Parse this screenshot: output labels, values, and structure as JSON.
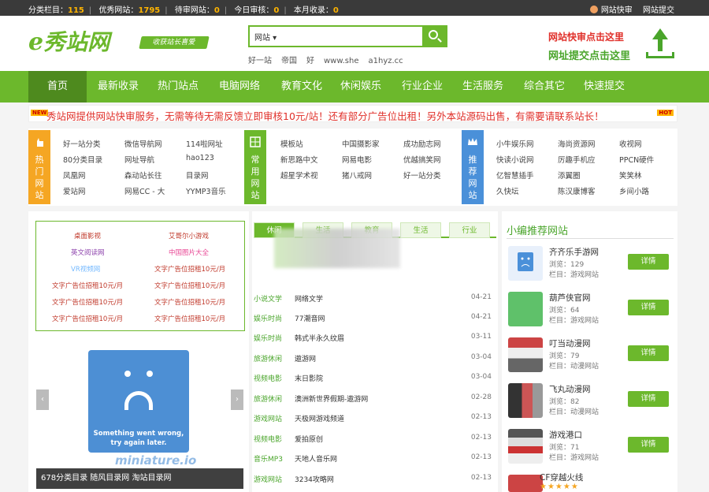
{
  "topbar": {
    "cat_label": "分类栏目：",
    "cat_count": "115",
    "site_label": "优秀网站：",
    "site_count": "1795",
    "pending_label": "待审网站：",
    "pending_count": "0",
    "today_label": "今日审核：",
    "today_count": "0",
    "month_label": "本月收录：",
    "month_count": "0",
    "link_fast": "网站快审",
    "link_submit": "网站提交"
  },
  "header": {
    "logo_text": "秀站网",
    "slogan": "收获站长喜爱",
    "search_type": "网站 ▾",
    "search_placeholder": "",
    "hotwords": [
      "好一站",
      "帝国",
      "好",
      "www.she",
      "a1hyz.cc"
    ],
    "quick_line1": "网站快审点击这里",
    "quick_line2": "网址提交点击这里"
  },
  "nav": {
    "items": [
      "首页",
      "最新收录",
      "热门站点",
      "电脑网络",
      "教育文化",
      "休闲娱乐",
      "行业企业",
      "生活服务",
      "综合其它",
      "快速提交"
    ]
  },
  "notice": {
    "new_badge": "NEW",
    "text": "秀站网提供网站快审服务，无需等待无需反馈立即审核10元/站！还有部分广告位出租！另外本站源码出售，有需要请联系站长！",
    "hot_badge": "HOT"
  },
  "cats": {
    "hot_label": "热门网站",
    "common_label": "常用网站",
    "recommend_label": "推荐网站",
    "hot_links": [
      "好一站分类",
      "微信导航网",
      "114啦网址",
      "80分类目录",
      "网址导航",
      "hao123",
      "凤凰网",
      "森动站长往",
      "目录网",
      "爱站网",
      "网易CC - 大",
      "YYMP3音乐"
    ],
    "common_links": [
      "模板站",
      "中国摄影家",
      "成功励志网",
      "新思路中文",
      "网易电影",
      "优越搞笑网",
      "超星学术视",
      "猪八戒网",
      "好一站分类"
    ],
    "recommend_links": [
      "小牛娱乐网",
      "海尚资源网",
      "收视网",
      "快读小说网",
      "厉趣手机应",
      "PPCN硬件",
      "亿智慧插手",
      "添翼圈",
      "笑笑林",
      "久快坛",
      "陈汉康博客",
      "乡间小路"
    ]
  },
  "adbox": {
    "items": [
      "桌面影视",
      "艾哥尔小游戏",
      "英文阅读网",
      "中国图片大全",
      "VR视频网",
      "文字广告位招租10元/月",
      "文字广告位招租10元/月",
      "文字广告位招租10元/月",
      "文字广告位招租10元/月",
      "文字广告位招租10元/月",
      "文字广告位招租10元/月",
      "文字广告位招租10元/月"
    ]
  },
  "slide": {
    "error_line1": "Something went wrong,",
    "error_line2": "try again later.",
    "watermark": "miniature.io",
    "caption": "678分类目录 随风目录网 淘站目录网",
    "prev": "‹",
    "next": "›"
  },
  "mid": {
    "tabs": [
      "休闲",
      "生活",
      "教育",
      "生活",
      "行业"
    ],
    "news": [
      {
        "cat": "小说文学",
        "title": "网络文学",
        "date": "04-21"
      },
      {
        "cat": "娱乐时尚",
        "title": "77潮音网",
        "date": "04-21"
      },
      {
        "cat": "娱乐时尚",
        "title": "韩式半永久纹眉",
        "date": "03-11"
      },
      {
        "cat": "旅游休闲",
        "title": "遨游网",
        "date": "03-04"
      },
      {
        "cat": "视频电影",
        "title": "末日影院",
        "date": "03-04"
      },
      {
        "cat": "旅游休闲",
        "title": "澳洲新世界假期-遨游网",
        "date": "02-28"
      },
      {
        "cat": "游戏网站",
        "title": "天极网游戏频道",
        "date": "02-13"
      },
      {
        "cat": "视频电影",
        "title": "爱拍原创",
        "date": "02-13"
      },
      {
        "cat": "音乐MP3",
        "title": "天地人音乐网",
        "date": "02-13"
      },
      {
        "cat": "游戏网站",
        "title": "3234攻略网",
        "date": "02-13"
      }
    ]
  },
  "right": {
    "title": "小编推荐网站",
    "detail_label": "详情",
    "views_prefix": "浏览：",
    "column_prefix": "栏目：",
    "items": [
      {
        "name": "齐齐乐手游网",
        "views": "浏览：129",
        "column": "栏目：游戏网站"
      },
      {
        "name": "葫芦侠官网",
        "views": "浏览：64",
        "column": "栏目：游戏网站"
      },
      {
        "name": "叮当动漫网",
        "views": "浏览：79",
        "column": "栏目：动漫网站"
      },
      {
        "name": "飞丸动漫网",
        "views": "浏览：82",
        "column": "栏目：动漫网站"
      },
      {
        "name": "游戏港口",
        "views": "浏览：71",
        "column": "栏目：游戏网站"
      }
    ],
    "last_name": "CF穿越火线",
    "last_stars": "★★★★★"
  },
  "colors": {
    "brand_green": "#6cb82c",
    "accent_orange": "#ffb400",
    "alert_red": "#e0302a",
    "blue": "#4a90d9"
  }
}
